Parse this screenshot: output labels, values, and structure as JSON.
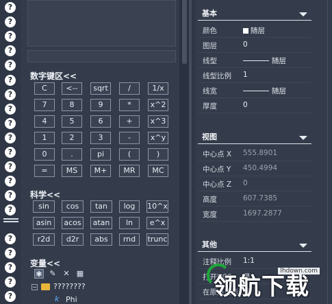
{
  "calc": {
    "keypad_title": "数字键区<<",
    "keypad_rows": [
      [
        "C",
        "<--",
        "sqrt",
        "/",
        "1/x"
      ],
      [
        "7",
        "8",
        "9",
        "*",
        "x^2"
      ],
      [
        "4",
        "5",
        "6",
        "+",
        "x^3"
      ],
      [
        "1",
        "2",
        "3",
        "-",
        "x^y"
      ],
      [
        "0",
        ".",
        "pi",
        "(",
        ")"
      ],
      [
        "=",
        "MS",
        "M+",
        "MR",
        "MC"
      ]
    ],
    "sci_title": "科学<<",
    "sci_rows": [
      [
        "sin",
        "cos",
        "tan",
        "log",
        "10^x"
      ],
      [
        "asin",
        "acos",
        "atan",
        "ln",
        "e^x"
      ],
      [
        "r2d",
        "d2r",
        "abs",
        "rnd",
        "trunc"
      ]
    ],
    "var_title": "变量<<",
    "tree_root": "????????",
    "tree_child": "Phi",
    "tree_child_icon": "k"
  },
  "props": {
    "groups": [
      {
        "title": "基本",
        "rows": [
          {
            "key": "颜色",
            "value": "随层",
            "swatch": "#ffffff"
          },
          {
            "key": "图层",
            "value": "0"
          },
          {
            "key": "线型",
            "value": "随层",
            "line": true
          },
          {
            "key": "线型比例",
            "value": "1"
          },
          {
            "key": "线宽",
            "value": "随层",
            "line": true
          },
          {
            "key": "厚度",
            "value": "0"
          }
        ]
      },
      {
        "title": "视图",
        "rows": [
          {
            "key": "中心点 X",
            "value": "555.8901",
            "dim": true
          },
          {
            "key": "中心点 Y",
            "value": "450.4994",
            "dim": true
          },
          {
            "key": "中心点 Z",
            "value": "0",
            "dim": true
          },
          {
            "key": "高度",
            "value": "607.7385",
            "dim": true
          },
          {
            "key": "宽度",
            "value": "1697.2877",
            "dim": true
          }
        ]
      },
      {
        "title": "其他",
        "rows": [
          {
            "key": "注释比例",
            "value": "1:1"
          },
          {
            "key": "打开UCS",
            "value": "是"
          },
          {
            "key": "在原点显示",
            "value": "是"
          }
        ]
      }
    ]
  },
  "watermark": {
    "text": "领航下载",
    "url": "lhdown.com"
  },
  "strip": {
    "icon_glyph": "?"
  }
}
